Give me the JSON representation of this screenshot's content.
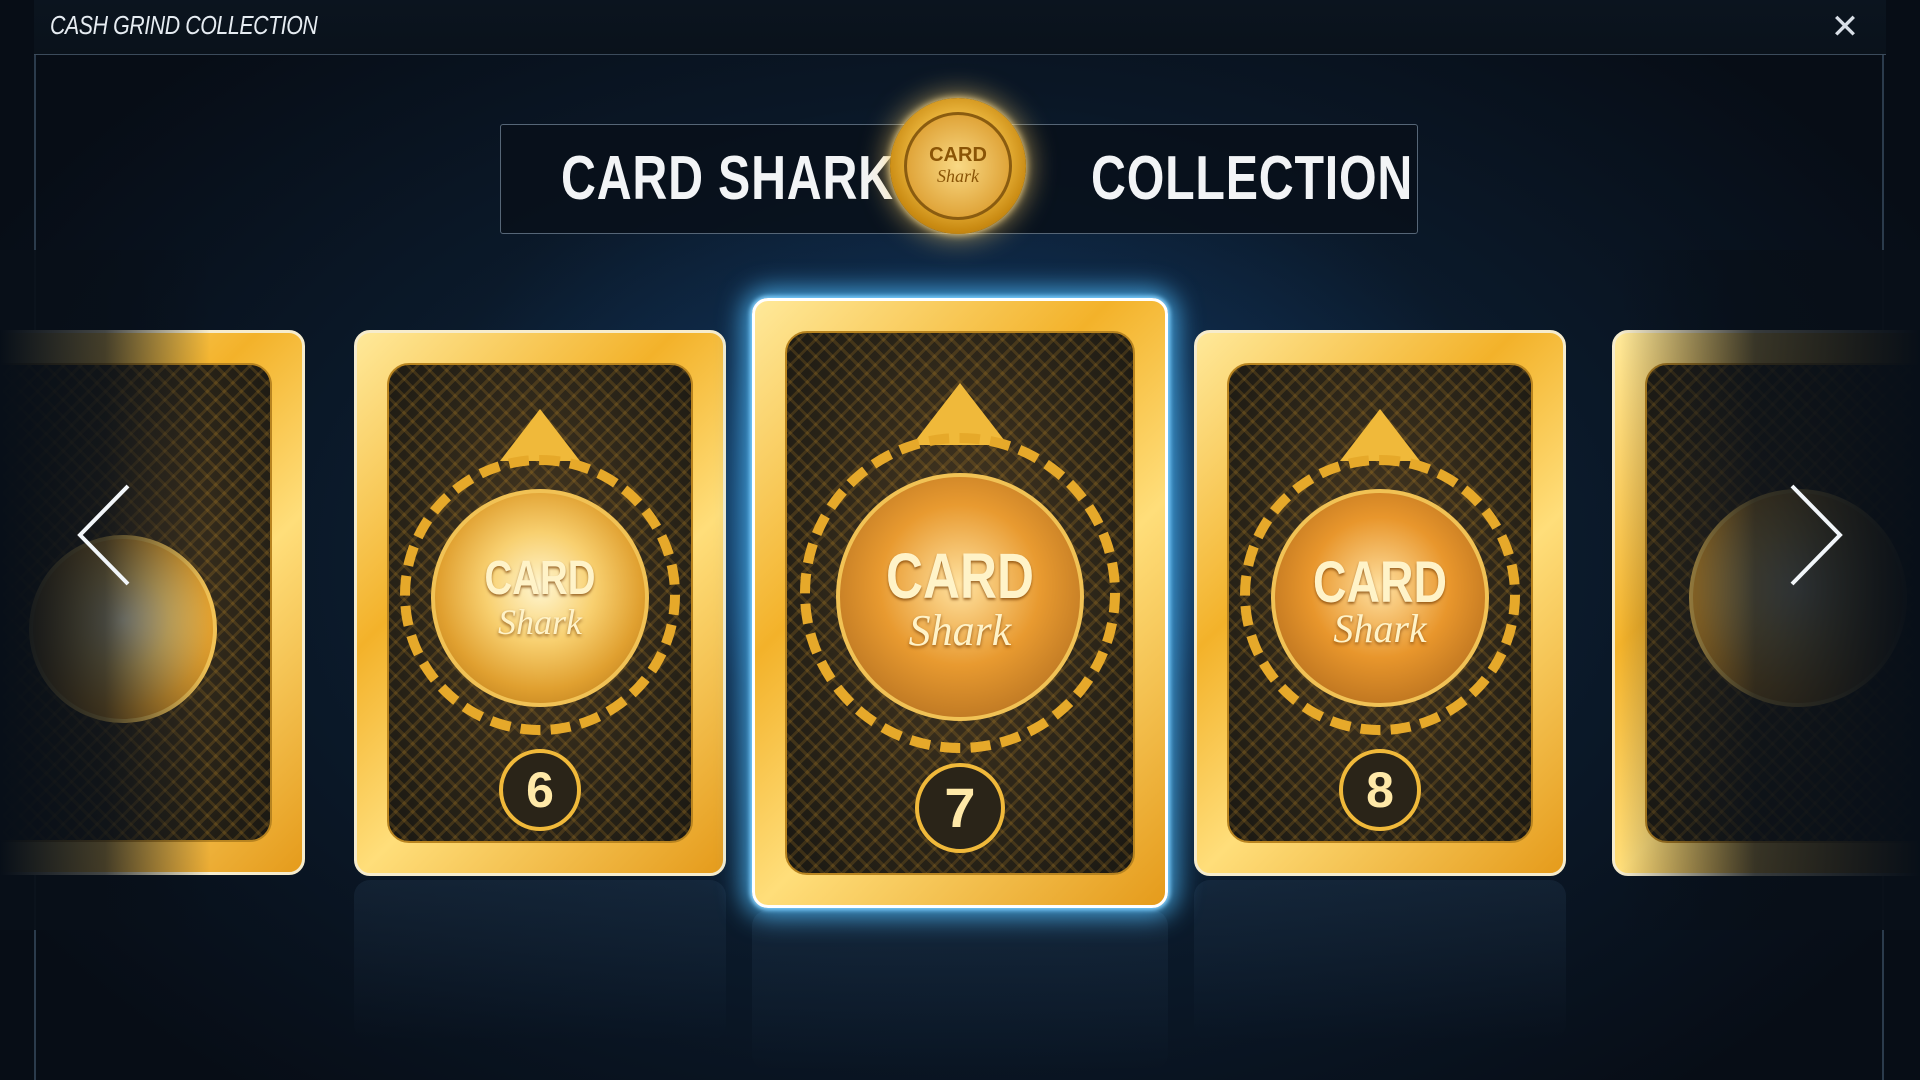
{
  "window": {
    "title": "CASH GRIND COLLECTION",
    "close_icon": "close-icon"
  },
  "banner": {
    "left_text": "CARD SHARK",
    "right_text": "COLLECTION",
    "medal_line1": "CARD",
    "medal_line2": "Shark"
  },
  "cards": [
    {
      "id": "prev-partial",
      "number": ""
    },
    {
      "id": "card-6",
      "number": "6",
      "medallion_top": "CARD",
      "medallion_bottom": "Shark"
    },
    {
      "id": "card-7",
      "number": "7",
      "medallion_top": "CARD",
      "medallion_bottom": "Shark",
      "selected": true
    },
    {
      "id": "card-8",
      "number": "8",
      "medallion_top": "CARD",
      "medallion_bottom": "Shark"
    },
    {
      "id": "next-partial",
      "number": ""
    }
  ],
  "navigation": {
    "prev_icon": "chevron-left-icon",
    "next_icon": "chevron-right-icon"
  },
  "colors": {
    "accent_glow": "#50beff",
    "gold": "#f0b93a",
    "background": "#080f18"
  }
}
